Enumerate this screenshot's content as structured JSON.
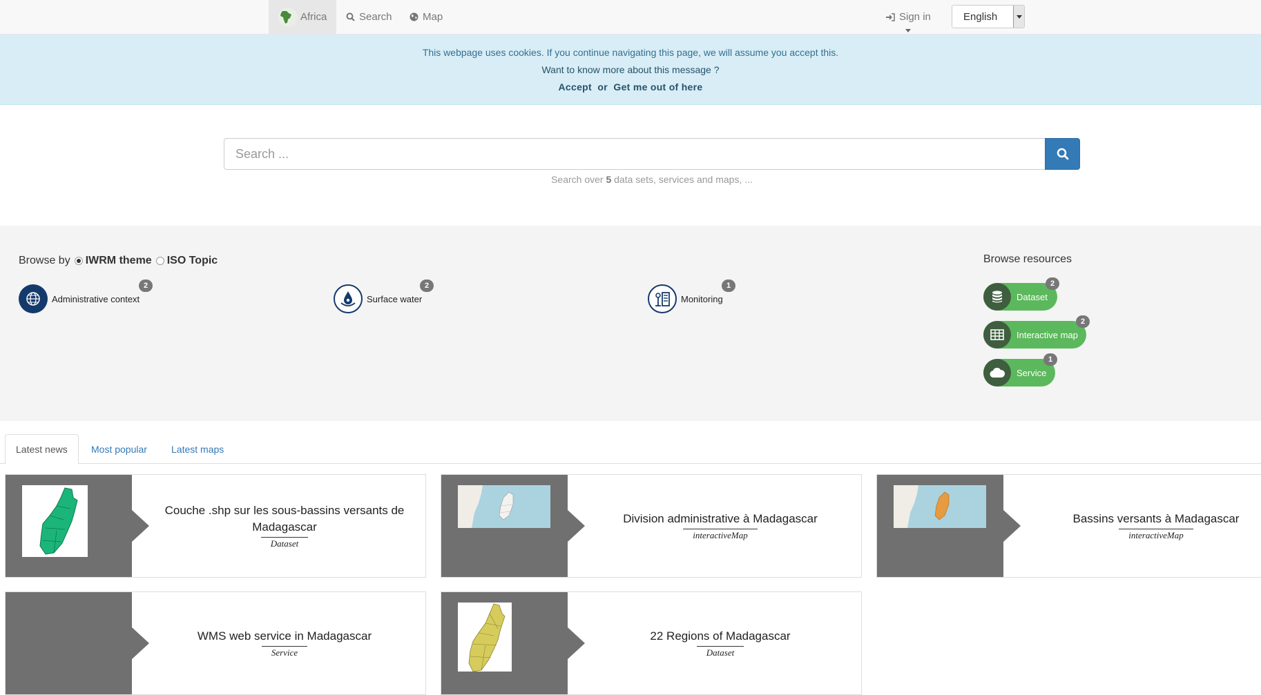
{
  "nav": {
    "home_label": "Africa",
    "search_label": "Search",
    "map_label": "Map",
    "signin_label": "Sign in",
    "language": "English"
  },
  "cookie": {
    "message": "This webpage uses cookies. If you continue navigating this page, we will assume you accept this.",
    "more_link": "Want to know more about this message ?",
    "accept_label": "Accept",
    "or_label": "or",
    "leave_label": "Get me out of here"
  },
  "search": {
    "placeholder": "Search ...",
    "hint_prefix": "Search over",
    "hint_count": "5",
    "hint_suffix": "data sets, services and maps, ..."
  },
  "browse": {
    "label": "Browse by",
    "options": [
      "IWRM theme",
      "ISO Topic"
    ],
    "selected": "IWRM theme",
    "topics": [
      {
        "label": "Administrative context",
        "count": "2",
        "icon": "globe-icon"
      },
      {
        "label": "Surface water",
        "count": "2",
        "icon": "water-drop-icon"
      },
      {
        "label": "Monitoring",
        "count": "1",
        "icon": "monitoring-station-icon"
      }
    ],
    "resources_title": "Browse resources",
    "resources": [
      {
        "label": "Dataset",
        "count": "2",
        "icon": "database-icon"
      },
      {
        "label": "Interactive map",
        "count": "2",
        "icon": "table-grid-icon"
      },
      {
        "label": "Service",
        "count": "1",
        "icon": "cloud-icon"
      }
    ]
  },
  "tabs": [
    "Latest news",
    "Most popular",
    "Latest maps"
  ],
  "active_tab": "Latest news",
  "cards": [
    {
      "title": "Couche .shp sur les sous-bassins versants de Madagascar",
      "type": "Dataset"
    },
    {
      "title": "Division administrative à Madagascar",
      "type": "interactiveMap"
    },
    {
      "title": "Bassins versants à Madagascar",
      "type": "interactiveMap"
    },
    {
      "title": "WMS web service in Madagascar",
      "type": "Service"
    },
    {
      "title": "22 Regions of Madagascar",
      "type": "Dataset"
    }
  ],
  "colors": {
    "primary": "#337ab7",
    "success": "#5cb85c",
    "info_bg": "#d9edf7",
    "topic_icon": "#143a6b",
    "thumb_bg": "#707070"
  }
}
